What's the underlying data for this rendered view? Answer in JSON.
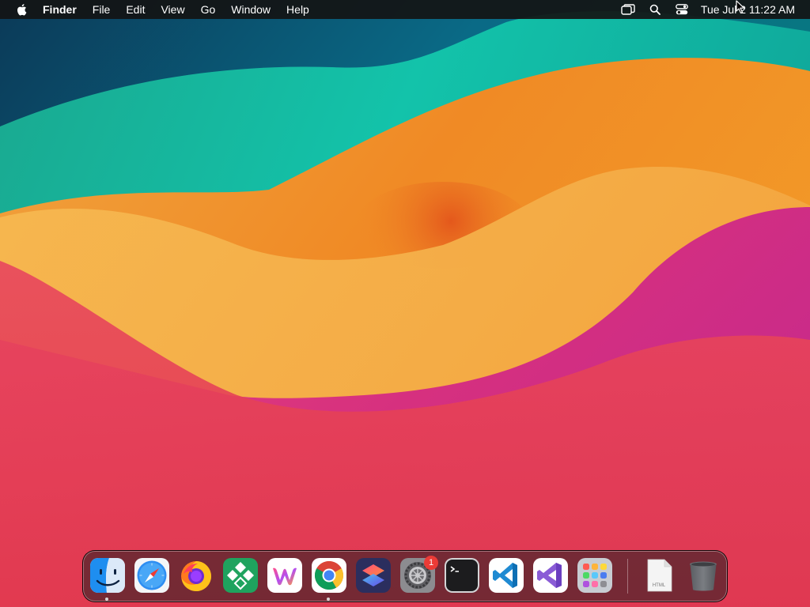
{
  "menubar": {
    "apple_icon": "apple-logo-icon",
    "app_name": "Finder",
    "menus": [
      "File",
      "Edit",
      "View",
      "Go",
      "Window",
      "Help"
    ],
    "status_icons": [
      "screen-mirroring-icon",
      "spotlight-search-icon",
      "control-center-icon"
    ],
    "clock": "Tue Jul 2  11:22 AM"
  },
  "dock": {
    "apps": [
      {
        "name": "finder",
        "icon": "finder-icon",
        "running": true
      },
      {
        "name": "safari",
        "icon": "safari-icon",
        "running": false
      },
      {
        "name": "firefox",
        "icon": "firefox-icon",
        "running": false
      },
      {
        "name": "app-store-alt",
        "icon": "green-diamond-app-icon",
        "running": false
      },
      {
        "name": "writer",
        "icon": "colorful-w-app-icon",
        "running": false
      },
      {
        "name": "chrome",
        "icon": "chrome-icon",
        "running": true
      },
      {
        "name": "shortcuts",
        "icon": "shortcuts-icon",
        "running": false
      },
      {
        "name": "system-settings",
        "icon": "system-settings-icon",
        "running": false,
        "badge": "1"
      },
      {
        "name": "terminal",
        "icon": "terminal-icon",
        "running": false
      },
      {
        "name": "vscode",
        "icon": "vscode-icon",
        "running": false
      },
      {
        "name": "visual-studio",
        "icon": "visual-studio-icon",
        "running": false
      },
      {
        "name": "launchpad",
        "icon": "launchpad-icon",
        "running": false
      }
    ],
    "files": [
      {
        "name": "html-document",
        "icon": "html-file-icon",
        "label": "HTML"
      },
      {
        "name": "trash",
        "icon": "trash-icon"
      }
    ]
  },
  "colors": {
    "menubar_bg": "#141414",
    "badge_red": "#ec3b36"
  }
}
